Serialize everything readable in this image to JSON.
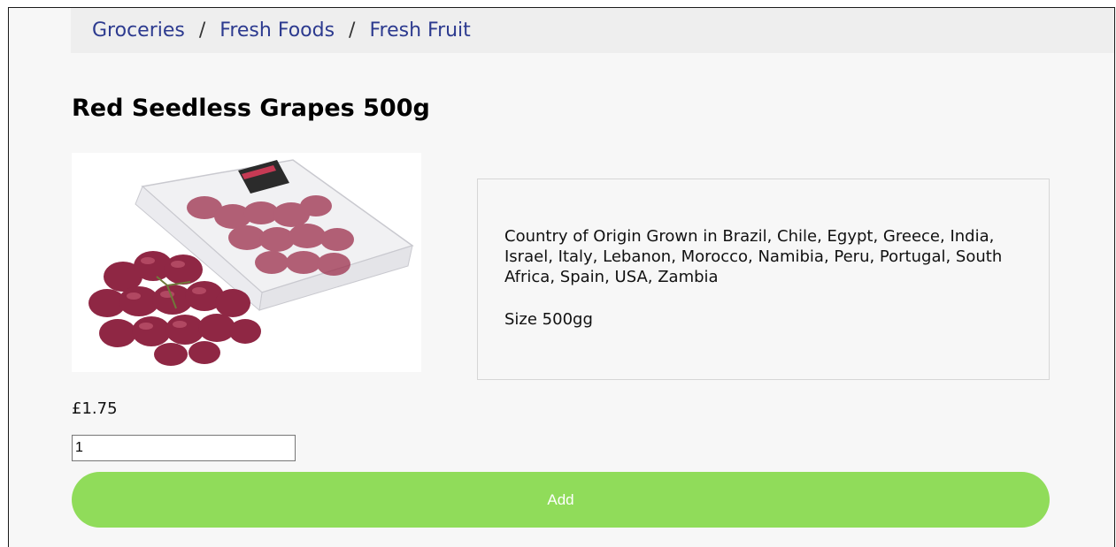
{
  "breadcrumb": {
    "items": [
      "Groceries",
      "Fresh Foods",
      "Fresh Fruit"
    ],
    "separator": "/"
  },
  "product": {
    "title": "Red Seedless Grapes 500g",
    "image_icon": "red-grapes-in-punnet",
    "description": {
      "origin": "Country of Origin Grown in Brazil, Chile, Egypt, Greece, India, Israel, Italy, Lebanon, Morocco, Namibia, Peru, Portugal, South Africa, Spain, USA, Zambia",
      "size": "Size 500gg"
    },
    "price": "£1.75",
    "quantity": "1",
    "add_label": "Add"
  },
  "colors": {
    "link": "#2c3a8f",
    "button": "#90dc5a",
    "breadcrumb_bg": "#eeeeee",
    "page_bg": "#f7f7f7"
  }
}
